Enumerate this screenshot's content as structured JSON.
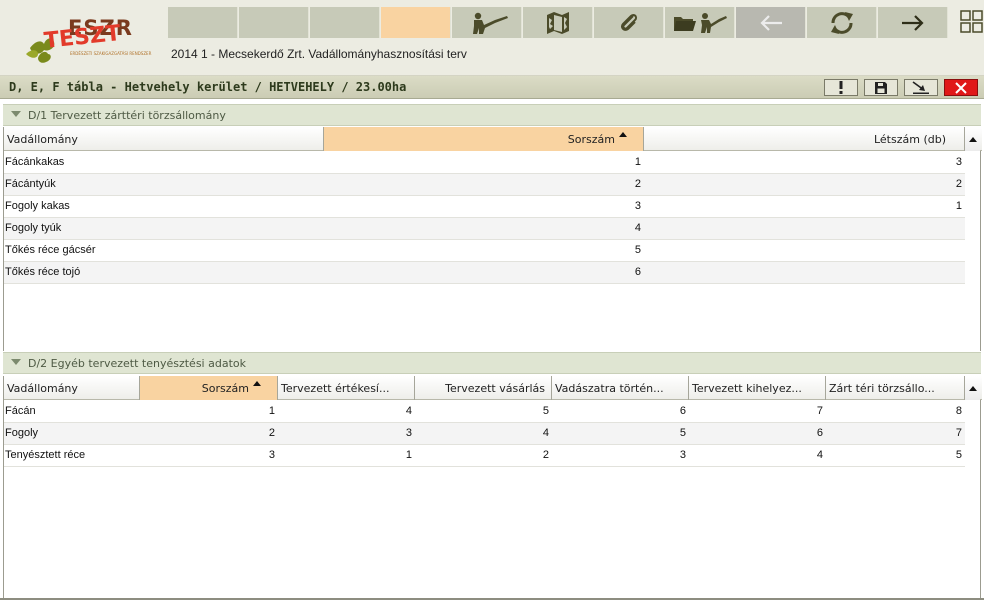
{
  "app": {
    "logo_text_main": "ESZR",
    "logo_text_overlay": "TESZT",
    "logo_subtitle": "ERDÉSZETI SZAKIGAZGATÁSI RENDSZER",
    "header_title": "2014 1 - Mecsekerdő Zrt. Vadállományhasznosítási terv"
  },
  "toolbar": {
    "buttons": [
      {
        "icon": "empty-slot",
        "state": "normal"
      },
      {
        "icon": "empty-slot",
        "state": "normal"
      },
      {
        "icon": "empty-slot",
        "state": "normal"
      },
      {
        "icon": "empty-slot",
        "state": "active"
      },
      {
        "icon": "hunter-rifle-icon",
        "state": "normal"
      },
      {
        "icon": "map-icon",
        "state": "normal"
      },
      {
        "icon": "paperclip-icon",
        "state": "normal"
      },
      {
        "icon": "folder-hunter-icon",
        "state": "normal"
      },
      {
        "icon": "arrow-left-icon",
        "state": "disabled"
      },
      {
        "icon": "refresh-icon",
        "state": "normal"
      },
      {
        "icon": "arrow-right-icon",
        "state": "normal"
      }
    ],
    "colors": {
      "normal": "#c7cab8",
      "active": "#f9d3a1",
      "disabled": "#b8b8b0",
      "icon": "#4b4b2a"
    }
  },
  "titlebar": {
    "title": "D, E, F tábla - Hetvehely kerület / HETVEHELY / 23.00ha",
    "buttons": [
      "exclamation-icon",
      "save-icon",
      "export-icon",
      "close-icon"
    ]
  },
  "section1": {
    "title": "D/1 Tervezett zárttéri törzsállomány",
    "columns": [
      "Vadállomány",
      "Sorszám",
      "Létszám (db)"
    ],
    "sorted_column": 1,
    "rows": [
      [
        "Fácánkakas",
        "1",
        "3"
      ],
      [
        "Fácántyúk",
        "2",
        "2"
      ],
      [
        "Fogoly kakas",
        "3",
        "1"
      ],
      [
        "Fogoly tyúk",
        "4",
        ""
      ],
      [
        "Tőkés réce gácsér",
        "5",
        ""
      ],
      [
        "Tőkés réce tojó",
        "6",
        ""
      ]
    ]
  },
  "section2": {
    "title": "D/2 Egyéb tervezett tenyésztési adatok",
    "columns": [
      "Vadállomány",
      "Sorszám",
      "Tervezett értékesí...",
      "Tervezett vásárlás",
      "Vadászatra történ...",
      "Tervezett kihelyez...",
      "Zárt téri törzsállo..."
    ],
    "sorted_column": 1,
    "rows": [
      [
        "Fácán",
        "1",
        "4",
        "5",
        "6",
        "7",
        "8"
      ],
      [
        "Fogoly",
        "2",
        "3",
        "4",
        "5",
        "6",
        "7"
      ],
      [
        "Tenyésztett réce",
        "3",
        "1",
        "2",
        "3",
        "4",
        "5"
      ]
    ]
  },
  "colors": {
    "header_bg": "#ecece2",
    "titlebar_bg": "#d3d4bd",
    "section_header_bg": "#dfe5d2",
    "sorted_header_bg": "#f9d3a1",
    "close_red": "#e01818"
  }
}
